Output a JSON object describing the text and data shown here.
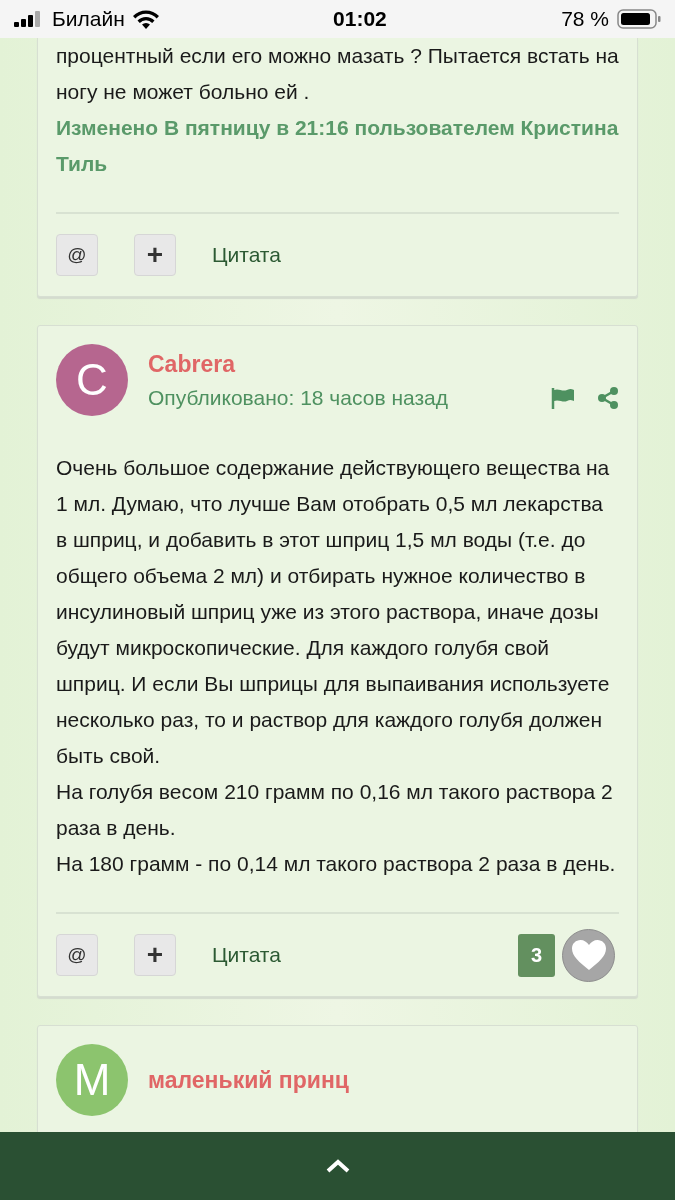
{
  "status_bar": {
    "carrier": "Билайн",
    "time": "01:02",
    "battery": "78 %"
  },
  "posts": [
    {
      "body": [
        "процентный если его можно мазать ? Пытается встать на ногу не может больно ей ."
      ],
      "edit_note": "Изменено В пятницу в 21:16 пользователем Кристина Тиль",
      "actions": {
        "mention": "@",
        "add": "+",
        "quote": "Цитата"
      }
    },
    {
      "author": {
        "initial": "C",
        "name": "Cabrera",
        "color": "#b6668f"
      },
      "published": "Опубликовано: 18 часов назад",
      "body": [
        "Очень большое содержание действующего вещества на 1 мл. Думаю, что лучше Вам отобрать 0,5 мл лекарства в шприц, и добавить в этот шприц 1,5 мл воды (т.е. до общего объема 2 мл) и отбирать нужное количество в инсулиновый шприц уже из этого раствора, иначе дозы будут микроскопические. Для каждого голубя свой шприц. И если Вы шприцы для выпаивания используете несколько раз, то и раствор для каждого голубя должен быть свой.",
        "На голубя весом 210 грамм по 0,16 мл такого раствора 2 раза в день.",
        "На 180 грамм - по 0,14 мл такого раствора 2 раза в день."
      ],
      "actions": {
        "mention": "@",
        "add": "+",
        "quote": "Цитата"
      },
      "likes": {
        "count": "3",
        "liked": false
      }
    },
    {
      "author": {
        "initial": "M",
        "name": "маленький принц",
        "color": "#8cc46e"
      }
    }
  ]
}
